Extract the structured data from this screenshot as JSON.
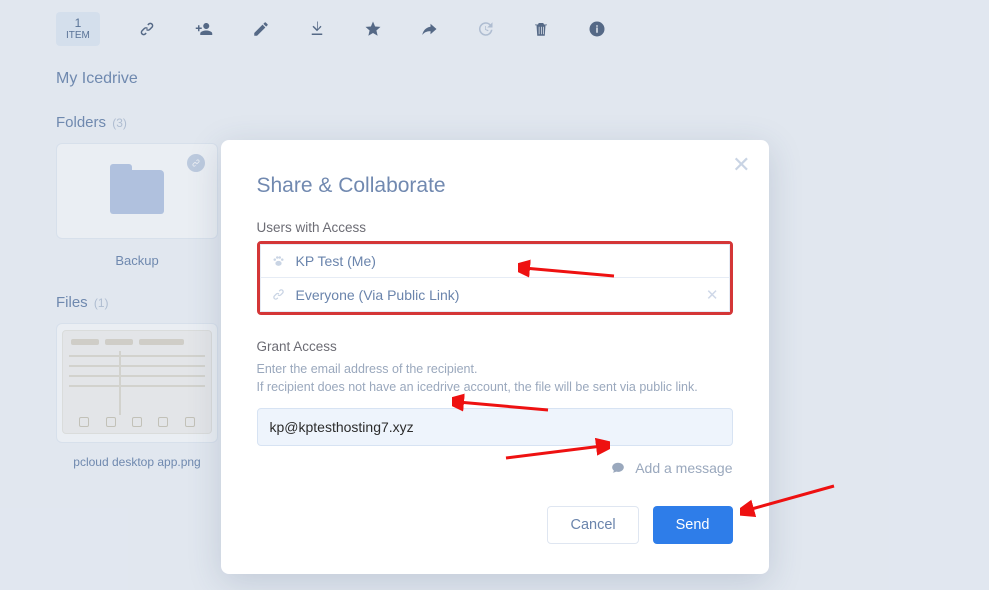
{
  "toolbar": {
    "selected_count": "1",
    "selected_label": "ITEM"
  },
  "breadcrumb": "My Icedrive",
  "folders": {
    "heading": "Folders",
    "count": "(3)",
    "items": [
      {
        "label": "Backup"
      }
    ]
  },
  "files": {
    "heading": "Files",
    "count": "(1)",
    "items": [
      {
        "label": "pcloud desktop app.png"
      }
    ]
  },
  "modal": {
    "title": "Share & Collaborate",
    "users_label": "Users with Access",
    "access": [
      {
        "name": "KP Test (Me)",
        "removable": false
      },
      {
        "name": "Everyone (Via Public Link)",
        "removable": true
      }
    ],
    "grant_label": "Grant Access",
    "help_line1": "Enter the email address of the recipient.",
    "help_line2": "If recipient does not have an icedrive account, the file will be sent via public link.",
    "email_value": "kp@kptesthosting7.xyz",
    "add_message": "Add a message",
    "cancel": "Cancel",
    "send": "Send"
  }
}
